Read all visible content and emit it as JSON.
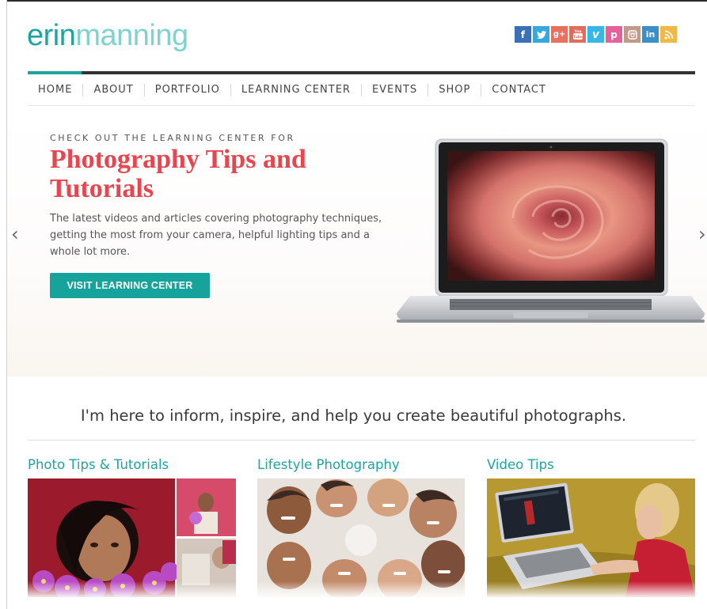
{
  "logo": {
    "part1": "erin",
    "part2": "manning"
  },
  "social": [
    {
      "icon": "facebook-icon",
      "glyph": "f",
      "color": "#3b6fb6"
    },
    {
      "icon": "twitter-icon",
      "glyph": "t",
      "color": "#33a9e0"
    },
    {
      "icon": "google-plus-icon",
      "glyph": "g+",
      "color": "#e8705f"
    },
    {
      "icon": "youtube-icon",
      "glyph": "You",
      "color": "#e46b59"
    },
    {
      "icon": "vimeo-icon",
      "glyph": "v",
      "color": "#38b6e5"
    },
    {
      "icon": "pinterest-icon",
      "glyph": "p",
      "color": "#e8609a"
    },
    {
      "icon": "instagram-icon",
      "glyph": "◙",
      "color": "#c19a8a"
    },
    {
      "icon": "linkedin-icon",
      "glyph": "in",
      "color": "#3a8fc6"
    },
    {
      "icon": "rss-icon",
      "glyph": "))",
      "color": "#f0b947"
    }
  ],
  "nav": [
    "HOME",
    "ABOUT",
    "PORTFOLIO",
    "LEARNING CENTER",
    "EVENTS",
    "SHOP",
    "CONTACT"
  ],
  "hero": {
    "eyebrow": "CHECK OUT THE LEARNING CENTER FOR",
    "title": "Photography Tips and Tutorials",
    "description": "The latest videos and articles covering photography techniques, getting the most from your camera, helpful lighting tips and a whole lot more.",
    "cta": "VISIT LEARNING CENTER",
    "prev": "‹",
    "next": "›"
  },
  "tagline": "I'm here to inform, inspire, and help you create beautiful photographs.",
  "columns": [
    {
      "title": "Photo Tips & Tutorials"
    },
    {
      "title": "Lifestyle Photography"
    },
    {
      "title": "Video Tips"
    }
  ],
  "colors": {
    "accent": "#1aa59e",
    "hero_title": "#e8454e",
    "cta": "#15a39b"
  }
}
